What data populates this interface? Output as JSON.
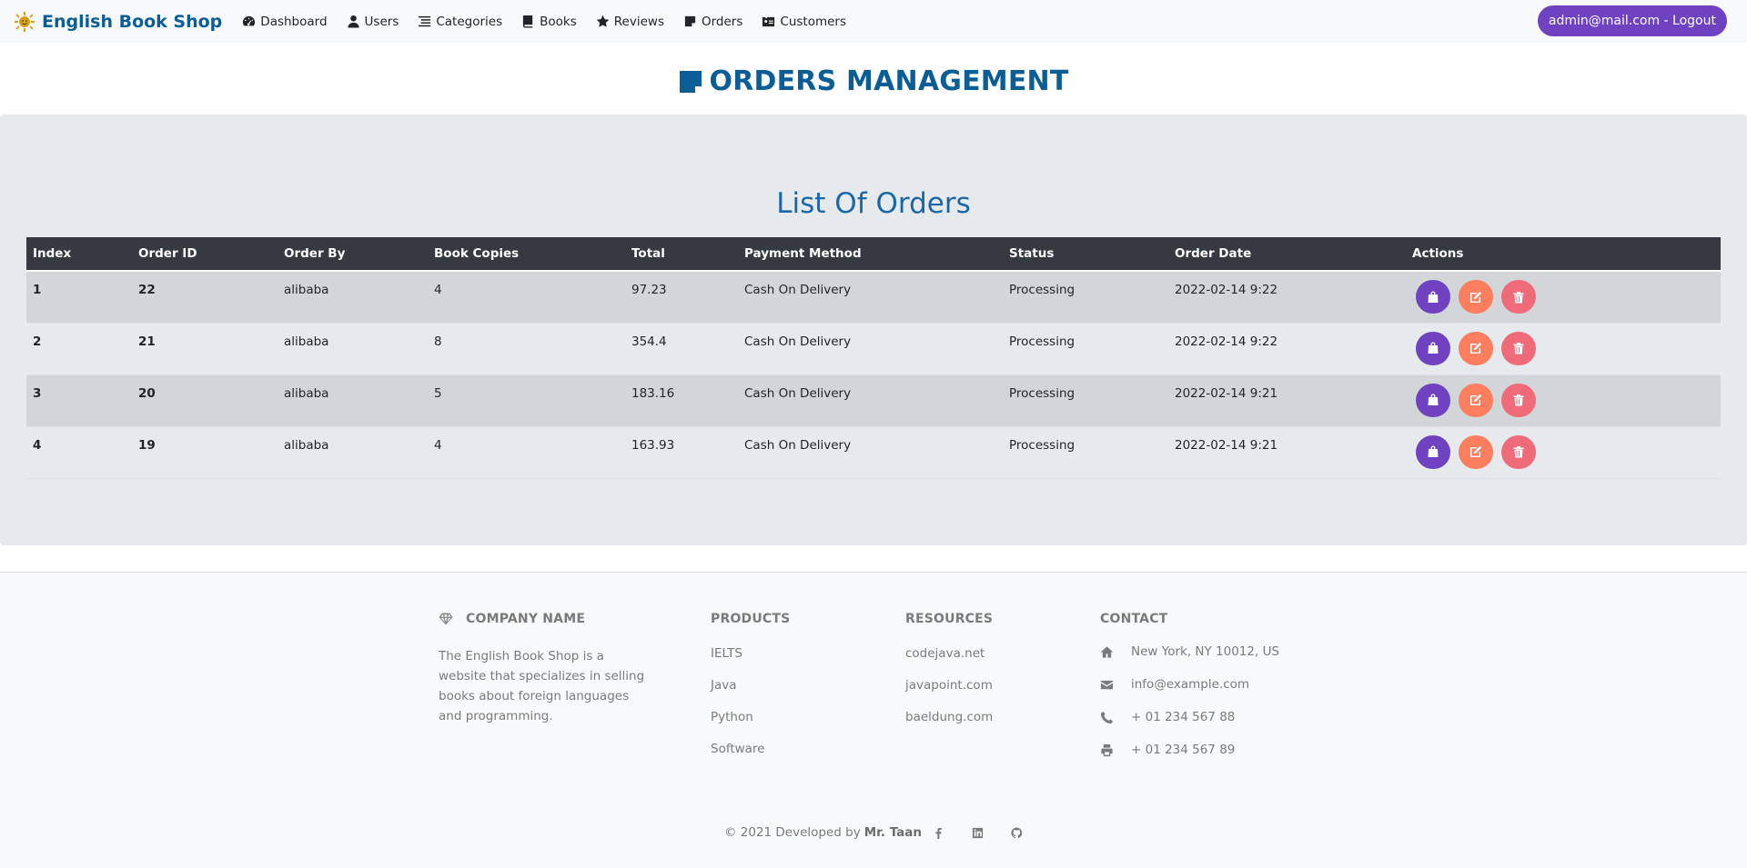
{
  "navbar": {
    "brand": "English Book Shop",
    "links": [
      {
        "label": "Dashboard",
        "icon": "dashboard-icon"
      },
      {
        "label": "Users",
        "icon": "user-icon"
      },
      {
        "label": "Categories",
        "icon": "list-icon"
      },
      {
        "label": "Books",
        "icon": "book-icon"
      },
      {
        "label": "Reviews",
        "icon": "star-icon"
      },
      {
        "label": "Orders",
        "icon": "note-icon"
      },
      {
        "label": "Customers",
        "icon": "id-card-icon"
      }
    ],
    "logout": "admin@mail.com - Logout"
  },
  "page": {
    "title": "ORDERS MANAGEMENT",
    "list_title": "List Of Orders"
  },
  "table": {
    "headers": [
      "Index",
      "Order ID",
      "Order By",
      "Book Copies",
      "Total",
      "Payment Method",
      "Status",
      "Order Date",
      "Actions"
    ],
    "rows": [
      {
        "index": "1",
        "order_id": "22",
        "order_by": "alibaba",
        "copies": "4",
        "total": "97.23",
        "payment": "Cash On Delivery",
        "status": "Processing",
        "date": "2022-02-14 9:22"
      },
      {
        "index": "2",
        "order_id": "21",
        "order_by": "alibaba",
        "copies": "8",
        "total": "354.4",
        "payment": "Cash On Delivery",
        "status": "Processing",
        "date": "2022-02-14 9:22"
      },
      {
        "index": "3",
        "order_id": "20",
        "order_by": "alibaba",
        "copies": "5",
        "total": "183.16",
        "payment": "Cash On Delivery",
        "status": "Processing",
        "date": "2022-02-14 9:21"
      },
      {
        "index": "4",
        "order_id": "19",
        "order_by": "alibaba",
        "copies": "4",
        "total": "163.93",
        "payment": "Cash On Delivery",
        "status": "Processing",
        "date": "2022-02-14 9:21"
      }
    ]
  },
  "footer": {
    "company_heading": "COMPANY NAME",
    "company_desc": "The English Book Shop is a website that specializes in selling books about foreign languages and programming.",
    "products_heading": "PRODUCTS",
    "products": [
      "IELTS",
      "Java",
      "Python",
      "Software"
    ],
    "resources_heading": "RESOURCES",
    "resources": [
      "codejava.net",
      "javapoint.com",
      "baeldung.com"
    ],
    "contact_heading": "CONTACT",
    "contact": {
      "address": "New York, NY 10012, US",
      "email": "info@example.com",
      "phone": "+ 01 234 567 88",
      "fax": "+ 01 234 567 89"
    },
    "copyright": "© 2021 Developed by",
    "developer": "Mr. Taan"
  },
  "colors": {
    "brand": "#0b5d95",
    "accent_purple": "#6f42c1",
    "edit_orange": "#fd7e5e",
    "delete_pink": "#f06b7a",
    "table_header": "#343a40"
  }
}
